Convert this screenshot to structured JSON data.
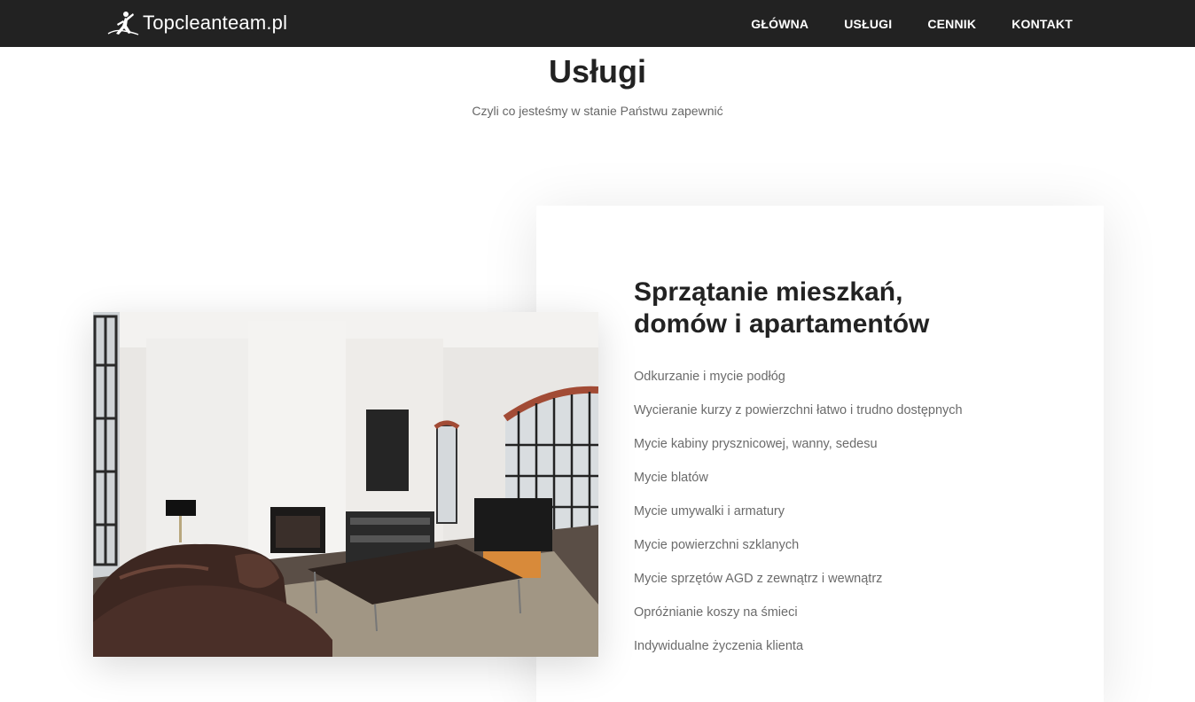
{
  "header": {
    "brand": "Topcleanteam.pl",
    "nav": [
      "GŁÓWNA",
      "USŁUGI",
      "CENNIK",
      "KONTAKT"
    ]
  },
  "section": {
    "title": "Usługi",
    "subtitle": "Czyli co jesteśmy w stanie Państwu zapewnić"
  },
  "service_card": {
    "title_line1": "Sprzątanie mieszkań,",
    "title_line2": "domów i apartamentów",
    "items": [
      "Odkurzanie i mycie podłóg",
      "Wycieranie kurzy z powierzchni łatwo i trudno dostępnych",
      "Mycie kabiny prysznicowej, wanny, sedesu",
      "Mycie blatów",
      "Mycie umywalki i armatury",
      "Mycie powierzchni szklanych",
      "Mycie sprzętów AGD z zewnątrz i wewnątrz",
      "Opróżnianie koszy na śmieci",
      "Indywidualne życzenia klienta"
    ]
  },
  "icons": {
    "logo": "cleaning-person-logo-icon"
  },
  "colors": {
    "navbar_bg": "#222222",
    "nav_text": "#ffffff",
    "heading": "#222222",
    "body_text": "#6b6b6b"
  }
}
